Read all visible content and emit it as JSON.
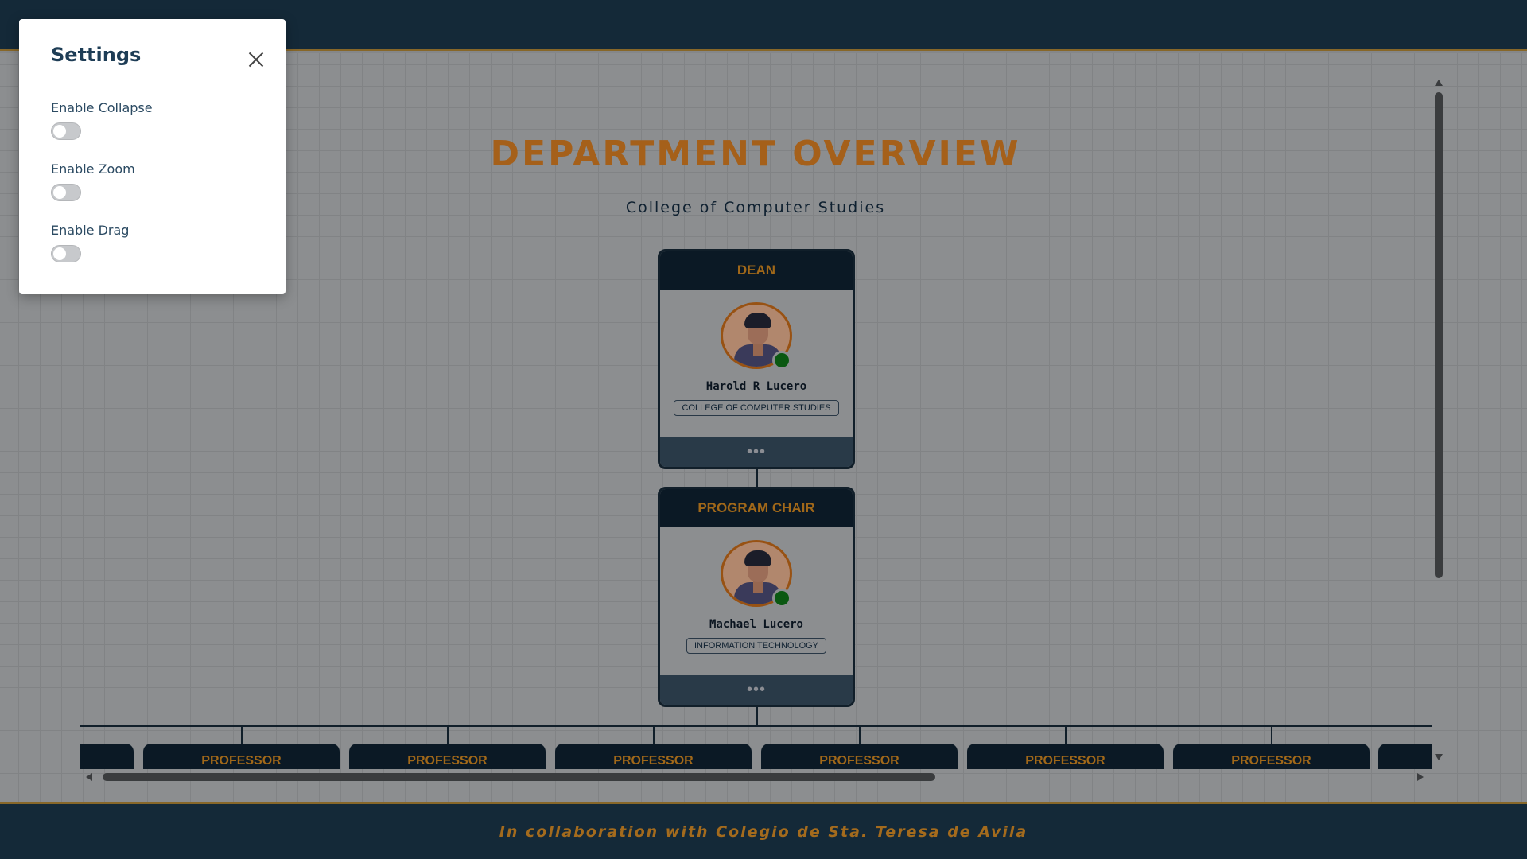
{
  "page": {
    "title": "DEPARTMENT OVERVIEW",
    "subtitle": "College of Computer Studies",
    "footer": "In collaboration with Colegio de Sta. Teresa de Avila"
  },
  "dean": {
    "role": "DEAN",
    "name": "Harold R Lucero",
    "department": "COLLEGE OF COMPUTER STUDIES",
    "menu": "•••",
    "status": "online",
    "status_color": "#0b5a12"
  },
  "chair": {
    "role": "PROGRAM CHAIR",
    "name": "Machael Lucero",
    "department": "INFORMATION TECHNOLOGY",
    "menu": "•••",
    "status": "online",
    "status_color": "#0b5a12"
  },
  "professors": [
    {
      "role": ""
    },
    {
      "role": "PROFESSOR"
    },
    {
      "role": "PROFESSOR"
    },
    {
      "role": "PROFESSOR"
    },
    {
      "role": "PROFESSOR"
    },
    {
      "role": "PROFESSOR"
    },
    {
      "role": "PROFESSOR"
    },
    {
      "role": ""
    }
  ],
  "settings": {
    "title": "Settings",
    "close_icon": "close-icon",
    "options": [
      {
        "label": "Enable Collapse",
        "enabled": false
      },
      {
        "label": "Enable Zoom",
        "enabled": false
      },
      {
        "label": "Enable Drag",
        "enabled": false
      }
    ]
  },
  "colors": {
    "header_bg": "#152a3a",
    "accent_orange": "#a9621b",
    "card_head": "#0c1a26"
  }
}
